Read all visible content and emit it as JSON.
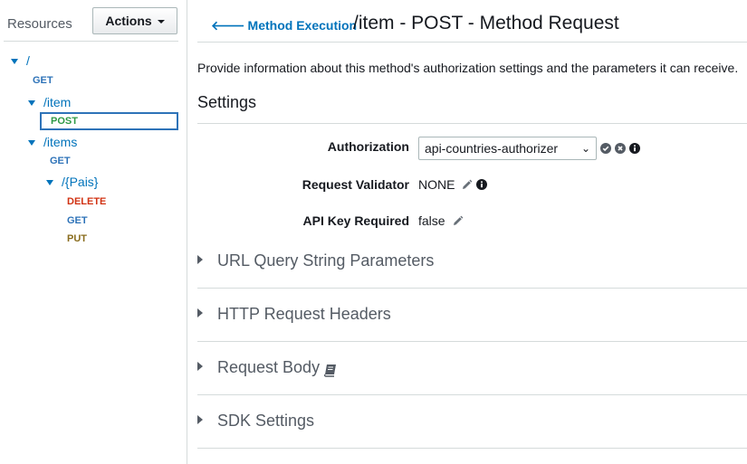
{
  "sidebar": {
    "title": "Resources",
    "actions_label": "Actions",
    "tree": {
      "root": "/",
      "root_get": "GET",
      "item": "/item",
      "item_post": "POST",
      "items": "/items",
      "items_get": "GET",
      "pais": "/{Pais}",
      "pais_delete": "DELETE",
      "pais_get": "GET",
      "pais_put": "PUT"
    }
  },
  "header": {
    "back_label": "Method Execution",
    "title": "/item - POST - Method Request"
  },
  "main": {
    "description": "Provide information about this method's authorization settings and the parameters it can receive.",
    "settings_heading": "Settings",
    "authorization": {
      "label": "Authorization",
      "selected": "api-countries-authorizer"
    },
    "request_validator": {
      "label": "Request Validator",
      "value": "NONE"
    },
    "api_key": {
      "label": "API Key Required",
      "value": "false"
    },
    "sections": [
      {
        "label": "URL Query String Parameters"
      },
      {
        "label": "HTTP Request Headers"
      },
      {
        "label": "Request Body"
      },
      {
        "label": "SDK Settings"
      }
    ]
  },
  "colors": {
    "link": "#0073bb",
    "get": "#2e73b8",
    "post": "#2e9a45",
    "delete": "#d13212",
    "put": "#8a6d1f",
    "divider": "#d5dbdb"
  },
  "icons": [
    "caret-down-icon",
    "tree-toggle-icon",
    "back-arrow-icon",
    "chevron-down-icon",
    "check-circle-icon",
    "cancel-circle-icon",
    "info-circle-icon",
    "pencil-icon",
    "book-icon",
    "expand-arrow-icon"
  ]
}
